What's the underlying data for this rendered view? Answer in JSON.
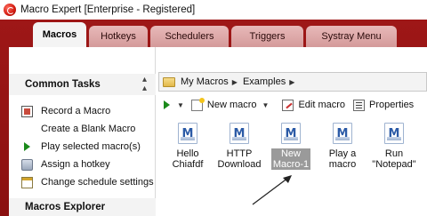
{
  "window": {
    "title": "Macro Expert [Enterprise - Registered]"
  },
  "tabs": [
    {
      "label": "Macros",
      "active": true
    },
    {
      "label": "Hotkeys",
      "active": false
    },
    {
      "label": "Schedulers",
      "active": false
    },
    {
      "label": "Triggers",
      "active": false
    },
    {
      "label": "Systray Menu",
      "active": false
    }
  ],
  "left_pane": {
    "common_tasks_title": "Common Tasks",
    "tasks": [
      {
        "label": "Record a Macro",
        "icon": "record-icon"
      },
      {
        "label": "Create a Blank Macro",
        "icon": ""
      },
      {
        "label": "Play selected macro(s)",
        "icon": "play-icon"
      },
      {
        "label": "Assign a hotkey",
        "icon": "keyboard-icon"
      },
      {
        "label": "Change schedule settings",
        "icon": "calendar-icon"
      }
    ],
    "explorer_title": "Macros Explorer"
  },
  "breadcrumb": [
    "My Macros",
    "Examples"
  ],
  "toolbar": {
    "new_macro": "New macro",
    "edit_macro": "Edit macro",
    "properties": "Properties"
  },
  "files": [
    {
      "label": "Hello\nChiafdf",
      "selected": false
    },
    {
      "label": "HTTP\nDownload",
      "selected": false
    },
    {
      "label": "New\nMacro-1",
      "selected": true
    },
    {
      "label": "Play a\nmacro",
      "selected": false
    },
    {
      "label": "Run\n\"Notepad\"",
      "selected": false
    }
  ],
  "colors": {
    "frame": "#9e1717",
    "tab_inactive": "#e0abab",
    "selection": "#9a9a9a",
    "play_green": "#1a8a1a"
  }
}
